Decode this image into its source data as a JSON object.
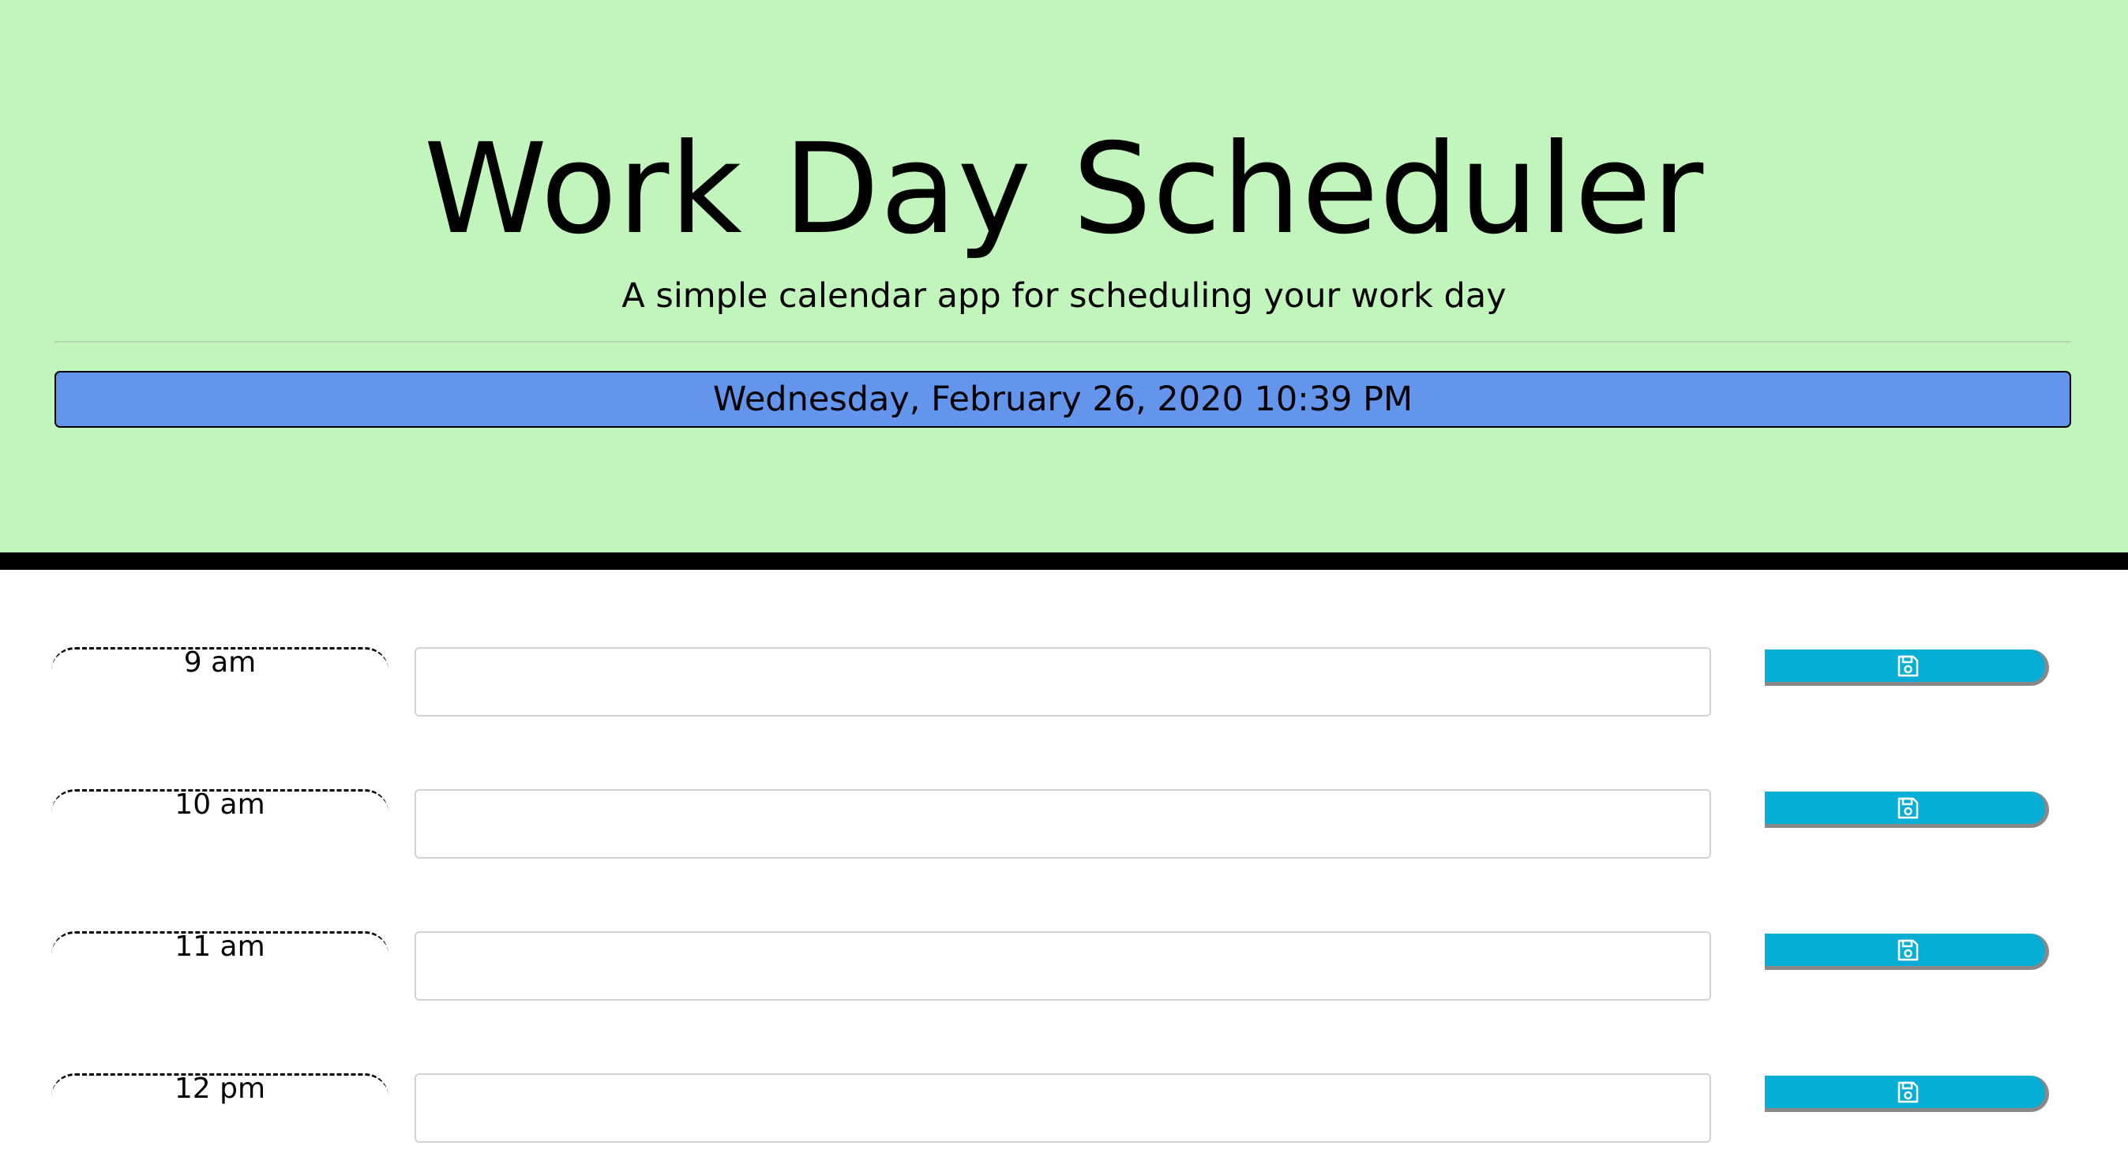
{
  "header": {
    "title": "Work Day Scheduler",
    "subtitle": "A simple calendar app for scheduling your work day",
    "current_day": "Wednesday, February 26, 2020 10:39 PM"
  },
  "rows": [
    {
      "hour": "9 am",
      "text": ""
    },
    {
      "hour": "10 am",
      "text": ""
    },
    {
      "hour": "11 am",
      "text": ""
    },
    {
      "hour": "12 pm",
      "text": ""
    }
  ],
  "icons": {
    "save": "floppy-disk-icon"
  },
  "colors": {
    "header_bg": "#c2f5bb",
    "current_day_bg": "#6495ed",
    "save_button": "#06aed5",
    "header_border": "#000000"
  }
}
